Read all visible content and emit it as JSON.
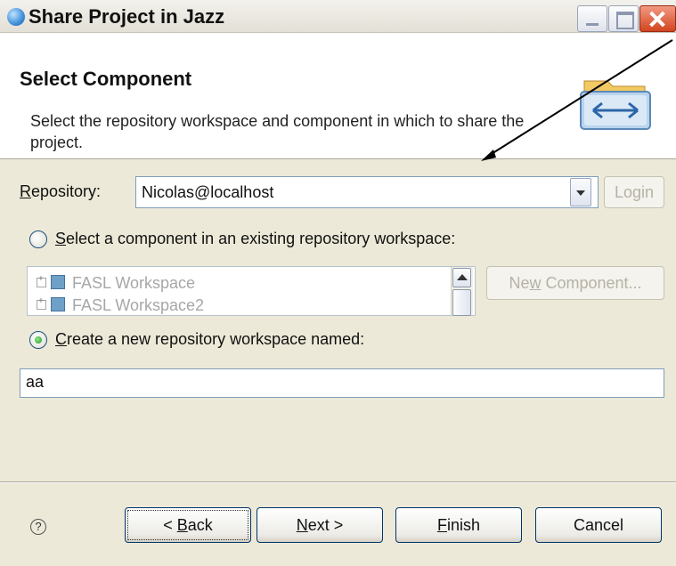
{
  "window": {
    "title": "Share Project in Jazz",
    "icon": "jazz-globe-icon"
  },
  "banner": {
    "title": "Select Component",
    "description": "Select the repository workspace and component in which to share the project.",
    "image": "folder-transfer-icon"
  },
  "repository": {
    "label_mnemonic": "R",
    "label_rest": "epository:",
    "value": "Nicolas@localhost",
    "login_label": "Login"
  },
  "existing_option": {
    "prefix": "",
    "mnemonic": "S",
    "rest": "elect a component in an existing repository workspace:",
    "checked": false
  },
  "tree": {
    "items": [
      "FASL Workspace",
      "FASL Workspace2"
    ]
  },
  "new_component": {
    "prefix": "Ne",
    "mnemonic": "w",
    "rest": " Component..."
  },
  "create_option": {
    "mnemonic": "C",
    "rest": "reate a new repository workspace named:",
    "checked": true
  },
  "name_field": {
    "value": "aa"
  },
  "footer": {
    "help_symbol": "?",
    "back_prefix": "< ",
    "back_mnemonic": "B",
    "back_rest": "ack",
    "next_mnemonic": "N",
    "next_rest": "ext >",
    "finish_mnemonic": "F",
    "finish_rest": "inish",
    "cancel_label": "Cancel"
  },
  "colors": {
    "dialog_bg": "#ece9d8",
    "annotation_arrow": "#000000"
  }
}
